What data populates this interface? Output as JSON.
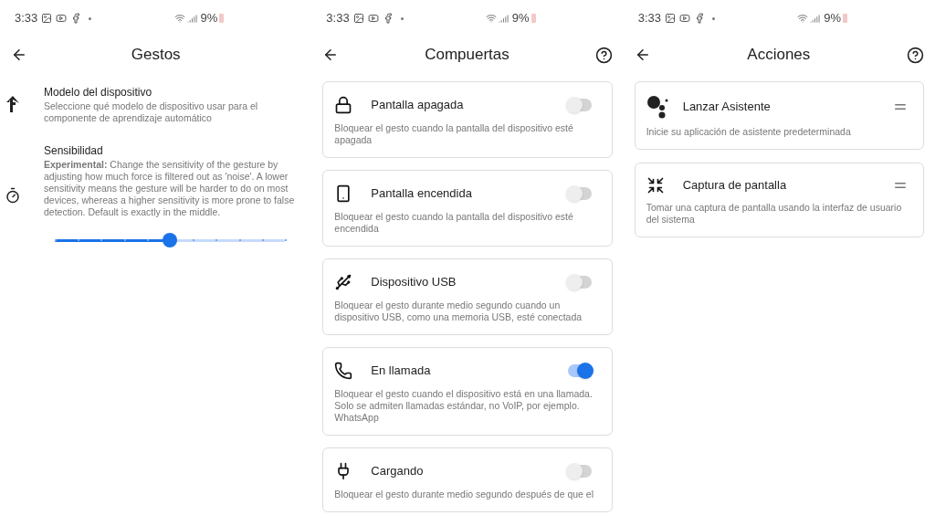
{
  "screens": [
    {
      "kind": "list",
      "status_bar": {
        "time": "3:33",
        "battery": "9%"
      },
      "title": "Gestos",
      "help_button": false,
      "items": [
        {
          "kind": "text",
          "title": "Modelo del dispositivo",
          "description": "Seleccione qué modelo de dispositivo usar para el componente de aprendizaje automático"
        },
        {
          "kind": "slider",
          "title": "Sensibilidad",
          "description": "**Experimental:** Change the sensitivity of the gesture by adjusting how much force is filtered out as 'noise'. A lower sensitivity means the gesture will be harder to do on most devices, whereas a higher sensitivity is more prone to false detection. Default is exactly in the middle.",
          "level": 0.5
        }
      ]
    },
    {
      "kind": "toggles",
      "status_bar": {
        "time": "3:33",
        "battery": "9%"
      },
      "title": "Compuertas",
      "help_button": true,
      "items": [
        {
          "title": "Pantalla apagada",
          "description": "Bloquear el gesto cuando la pantalla del dispositivo esté apagada",
          "on": false
        },
        {
          "title": "Pantalla encendida",
          "description": "Bloquear el gesto cuando la pantalla del dispositivo esté encendida",
          "on": false
        },
        {
          "title": "Dispositivo USB",
          "description": "Bloquear el gesto durante medio segundo cuando un dispositivo USB, como una memoria USB, esté conectada",
          "on": false
        },
        {
          "title": "En llamada",
          "description": "Bloquear el gesto cuando el dispositivo está en una llamada. Solo se admiten llamadas estándar, no VoIP, por ejemplo. WhatsApp",
          "on": true
        },
        {
          "title": "Cargando",
          "description": "Bloquear el gesto durante medio segundo después de que el",
          "on": false
        }
      ]
    },
    {
      "kind": "actions",
      "status_bar": {
        "time": "3:33",
        "battery": "9%"
      },
      "title": "Acciones",
      "help_button": true,
      "items": [
        {
          "title": "Lanzar Asistente",
          "description": "Inicie su aplicación de asistente predeterminada"
        },
        {
          "title": "Captura de pantalla",
          "description": "Tomar una captura de pantalla usando la interfaz de usuario del sistema"
        }
      ]
    }
  ]
}
